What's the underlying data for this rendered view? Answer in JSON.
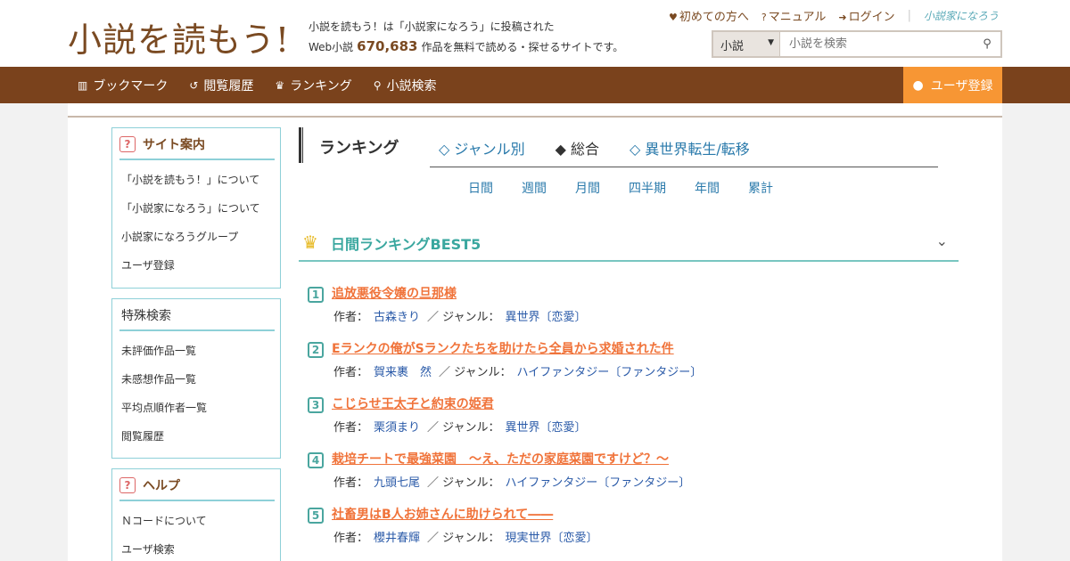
{
  "header": {
    "logo": "小説を読もう!",
    "tagline_line1": "小説を読もう！は「小説家になろう」に投稿された",
    "tagline_prefix": "Web小説",
    "work_count": "670,683",
    "tagline_suffix": "作品を無料で読める・探せるサイトです。",
    "links": [
      "初めての方へ",
      "マニュアル",
      "ログイン"
    ],
    "narou_logo": "小説家になろう"
  },
  "search": {
    "category": "小説",
    "placeholder": "小説を検索"
  },
  "nav": {
    "items": [
      "ブックマーク",
      "閲覧履歴",
      "ランキング",
      "小説検索"
    ],
    "register": "ユーザ登録"
  },
  "sidebar": {
    "site_guide": {
      "title": "サイト案内",
      "items": [
        "「小説を読もう！」について",
        "「小説家になろう」について",
        "小説家になろうグループ",
        "ユーザ登録"
      ]
    },
    "special_search": {
      "title": "特殊検索",
      "items": [
        "未評価作品一覧",
        "未感想作品一覧",
        "平均点順作者一覧",
        "閲覧履歴"
      ]
    },
    "help": {
      "title": "ヘルプ",
      "items": [
        "Ｎコードについて",
        "ユーザ検索"
      ]
    }
  },
  "ranking": {
    "title": "ランキング",
    "genre_tabs": [
      "◇ ジャンル別",
      "◆ 総合",
      "◇ 異世界転生/転移"
    ],
    "period_tabs": [
      "日間",
      "週間",
      "月間",
      "四半期",
      "年間",
      "累計"
    ],
    "best_title": "日間ランキングBEST5",
    "author_label": "作者：",
    "genre_label": "／ ジャンル：",
    "items": [
      {
        "rank": "1",
        "title": "追放悪役令嬢の旦那様",
        "author": "古森きり",
        "genre": "異世界〔恋愛〕"
      },
      {
        "rank": "2",
        "title": "Eランクの俺がSランクたちを助けたら全員から求婚された件",
        "author": "賀来裹　然",
        "genre": "ハイファンタジー〔ファンタジー〕"
      },
      {
        "rank": "3",
        "title": "こじらせ王太子と約束の姫君",
        "author": "栗須まり",
        "genre": "異世界〔恋愛〕"
      },
      {
        "rank": "4",
        "title": "栽培チートで最強菜園　～え、ただの家庭菜園ですけど？～",
        "author": "九頭七尾",
        "genre": "ハイファンタジー〔ファンタジー〕"
      },
      {
        "rank": "5",
        "title": "社畜男はB人お姉さんに助けられて――",
        "author": "櫻井春輝",
        "genre": "現実世界〔恋愛〕"
      }
    ]
  },
  "colors": {
    "brand_brown": "#7a421c",
    "register_orange": "#f79634",
    "link_orange": "#f0733a",
    "teal": "#3aa79f"
  }
}
